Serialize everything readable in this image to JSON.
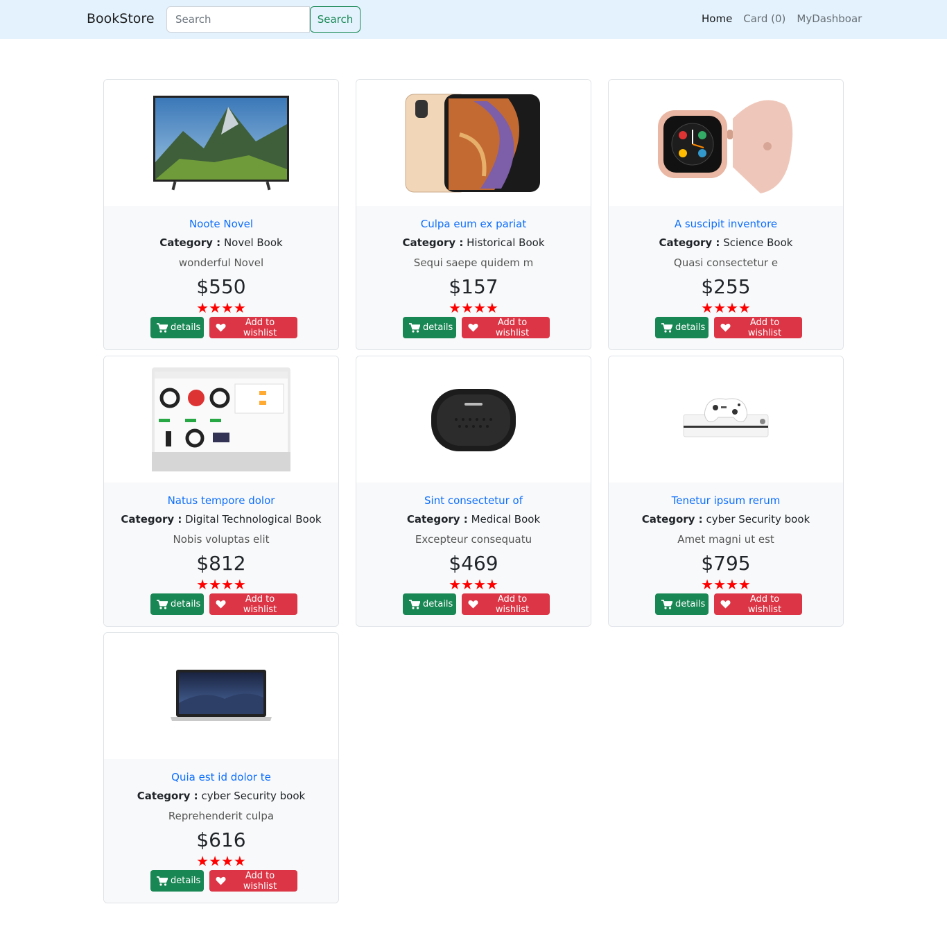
{
  "navbar": {
    "brand": "BookStore",
    "search_placeholder": "Search",
    "search_button": "Search",
    "links": [
      "Home",
      "Card (0)",
      "MyDashboar"
    ]
  },
  "labels": {
    "category": "Category :",
    "details": "details",
    "wishlist": "Add to wishlist",
    "stars": "★★★★"
  },
  "products": [
    {
      "title": "Noote Novel",
      "category": "Novel Book",
      "description": "wonderful Novel",
      "price": "$550",
      "image": "tv"
    },
    {
      "title": "Culpa eum ex pariat",
      "category": "Historical Book",
      "description": "Sequi saepe quidem m",
      "price": "$157",
      "image": "phone"
    },
    {
      "title": "A suscipit inventore",
      "category": "Science Book",
      "description": "Quasi consectetur e",
      "price": "$255",
      "image": "watch"
    },
    {
      "title": "Natus tempore dolor",
      "category": "Digital Technological Book",
      "description": "Nobis voluptas elit",
      "price": "$812",
      "image": "pos-screen"
    },
    {
      "title": "Sint consectetur of",
      "category": "Medical Book",
      "description": "Excepteur consequatu",
      "price": "$469",
      "image": "speaker"
    },
    {
      "title": "Tenetur ipsum rerum",
      "category": "cyber Security book",
      "description": "Amet magni ut est",
      "price": "$795",
      "image": "console"
    },
    {
      "title": "Quia est id dolor te",
      "category": "cyber Security book",
      "description": "Reprehenderit culpa",
      "price": "$616",
      "image": "laptop"
    }
  ]
}
